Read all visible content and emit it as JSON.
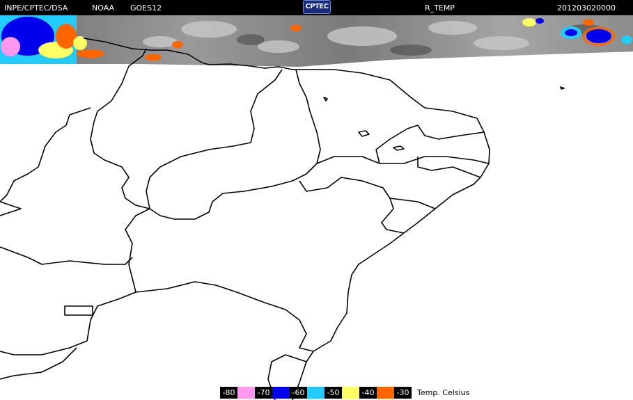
{
  "header": {
    "institution": "INPE/CPTEC/DSA",
    "agency": "NOAA",
    "satellite": "GOES12",
    "logo_text": "CPTEC",
    "product": "R_TEMP",
    "datetime": "201203020000"
  },
  "legend": {
    "title": "Temp. Celsius",
    "entries": [
      {
        "label": "-80",
        "color": "#ff99ee"
      },
      {
        "label": "-70",
        "color": "#0000ee"
      },
      {
        "label": "-60",
        "color": "#22ccff"
      },
      {
        "label": "-50",
        "color": "#ffff66"
      },
      {
        "label": "-40",
        "color": "#ff6600"
      },
      {
        "label": "-30",
        "color": null
      }
    ]
  },
  "colors": {
    "background": "#ffffff",
    "topbar": "#000000",
    "borders": "#000000",
    "cloud_gray": "#8a8a8a"
  }
}
